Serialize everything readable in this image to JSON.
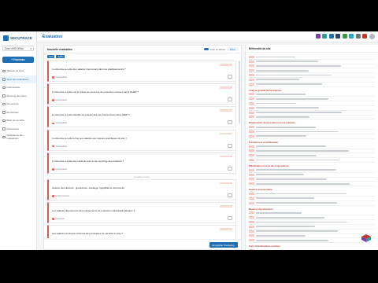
{
  "header": {
    "title": "Évaluation"
  },
  "brand": {
    "name": "SECUTRACE"
  },
  "org_selector": {
    "value": "Clan VSO ORAU"
  },
  "new_button": {
    "label": "+ Nouveau"
  },
  "sidebar": {
    "items": [
      {
        "icon": "home-icon",
        "label": "Tableau de bord",
        "active": false
      },
      {
        "icon": "clipboard-icon",
        "label": "Suivi des évaluations",
        "active": true
      },
      {
        "icon": "people-icon",
        "label": "Intervenants",
        "active": false
      },
      {
        "icon": "calendar-icon",
        "label": "Planning des plans",
        "active": false
      },
      {
        "icon": "document-icon",
        "label": "Documents",
        "active": false
      },
      {
        "icon": "building-icon",
        "label": "Entreprises",
        "active": false
      },
      {
        "icon": "chart-icon",
        "label": "Bilan de sécurité",
        "active": false
      },
      {
        "icon": "gear-icon",
        "label": "Paramètres",
        "active": false
      },
      {
        "icon": "grid-icon",
        "label": "Statistiques des évaluations",
        "active": false
      }
    ]
  },
  "app_icons": [
    {
      "name": "tile-purple-icon",
      "color": "#7b3fb0"
    },
    {
      "name": "tile-teal-icon",
      "color": "#2a9d8f"
    },
    {
      "name": "tile-blue-icon",
      "color": "#1f6fb2"
    },
    {
      "name": "tile-navy-icon",
      "color": "#26456e"
    },
    {
      "name": "tile-green-icon",
      "color": "#3a9a4a"
    },
    {
      "name": "tile-cyan-icon",
      "color": "#2aa7c9"
    },
    {
      "name": "tile-gray-icon",
      "color": "#6b7480"
    },
    {
      "name": "tile-red-icon",
      "color": "#c0392b"
    }
  ],
  "left_panel": {
    "title": "Nouvelle évaluation",
    "toggle_label": "Liste de tâches",
    "filter_label": "Filtrer",
    "chips": [
      "Tous",
      "Actifs"
    ],
    "divider_label": "Questions à traiter",
    "rows": [
      {
        "question": "L'entreprise a-t-elle des salariés intervenant dans les établissements ?",
        "meta": "Organisation"
      },
      {
        "question": "L'entreprise a-t-elle mis en place les mesures de protection prévues par le DUER ?",
        "meta": "Organisation"
      },
      {
        "question": "L'entreprise a-t-elle identifié les risques liés aux interventions dans l'ERP ?",
        "meta": "Organisation"
      },
      {
        "question": "L'entreprise a-t-elle formé ses salariés aux risques spécifiques du site ?",
        "meta": "Organisation"
      },
      {
        "question": "L'entreprise a-t-elle des outils de suivi et de reporting des incidents ?",
        "meta": "Organisation"
      },
      {
        "question": "Gestion des déchets : procédures, stockage, traçabilité et documents",
        "meta": "Environnement"
      },
      {
        "question": "Les salariés disposent-ils des équipements de protection individuelle adaptés ?",
        "meta": "Protection"
      },
      {
        "question": "Les salariés ont-ils été informés des consignes de sécurité du site ?",
        "meta": "Protection"
      }
    ],
    "save_label": "Enregistrer l'évaluation"
  },
  "right_panel": {
    "title": "Référentiel du site",
    "sections": [
      {
        "title": "",
        "items": 7
      },
      {
        "title": "Analyse globale de l'entreprise",
        "items": 6
      },
      {
        "title": "Organisation du personnel et sous-traitance",
        "items": 3
      },
      {
        "title": "Formation et sensibilisation",
        "items": 4
      },
      {
        "title": "Planification et suivi des interventions",
        "items": 4
      },
      {
        "title": "Gestion documentaire",
        "items": 3
      },
      {
        "title": "Mesures de prévention",
        "items": 7
      },
      {
        "title": "Suivi et amélioration continue",
        "items": 6
      }
    ]
  }
}
